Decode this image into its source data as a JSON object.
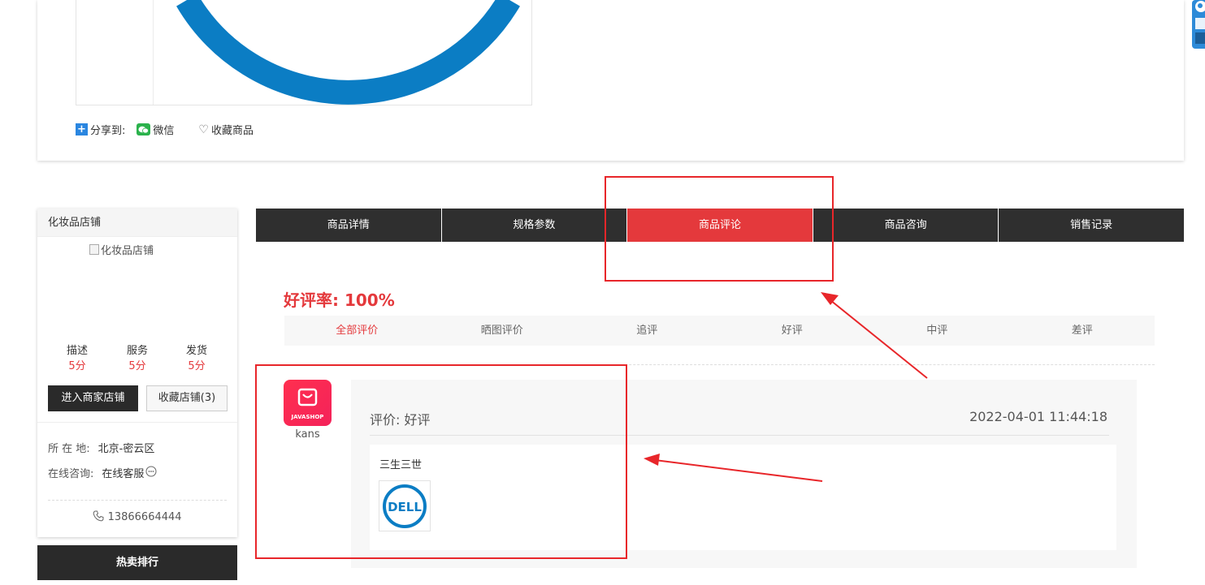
{
  "share": {
    "label": "分享到:",
    "wechat": "微信",
    "favorite_goods": "收藏商品"
  },
  "shop": {
    "title": "化妆品店铺",
    "logo_alt": "化妆品店铺",
    "scores": [
      {
        "label": "描述",
        "value": "5分"
      },
      {
        "label": "服务",
        "value": "5分"
      },
      {
        "label": "发货",
        "value": "5分"
      }
    ],
    "enter_button": "进入商家店铺",
    "favorite_button": "收藏店铺(3)",
    "location_key": "所 在 地:",
    "location_value": "北京-密云区",
    "consult_key": "在线咨询:",
    "consult_value": "在线客服",
    "phone": "13866664444"
  },
  "hot_rank": "热卖排行",
  "tabs": [
    {
      "label": "商品详情",
      "active": false
    },
    {
      "label": "规格参数",
      "active": false
    },
    {
      "label": "商品评论",
      "active": true
    },
    {
      "label": "商品咨询",
      "active": false
    },
    {
      "label": "销售记录",
      "active": false
    }
  ],
  "reviews": {
    "rate_label": "好评率:",
    "rate_value": "100%",
    "filters": [
      {
        "label": "全部评价",
        "active": true
      },
      {
        "label": "晒图评价",
        "active": false
      },
      {
        "label": "追评",
        "active": false
      },
      {
        "label": "好评",
        "active": false
      },
      {
        "label": "中评",
        "active": false
      },
      {
        "label": "差评",
        "active": false
      }
    ],
    "items": [
      {
        "avatar_text": "JAVASHOP",
        "username": "kans",
        "grade_label": "评价:",
        "grade_value": "好评",
        "time": "2022-04-01 11:44:18",
        "content": "三生三世",
        "image_brand": "DELL"
      }
    ]
  },
  "colors": {
    "accent_red": "#e4393c",
    "dark_tab": "#2f2f2f",
    "dell_blue": "#0b7dc4",
    "annotation_red": "#e8262a"
  }
}
